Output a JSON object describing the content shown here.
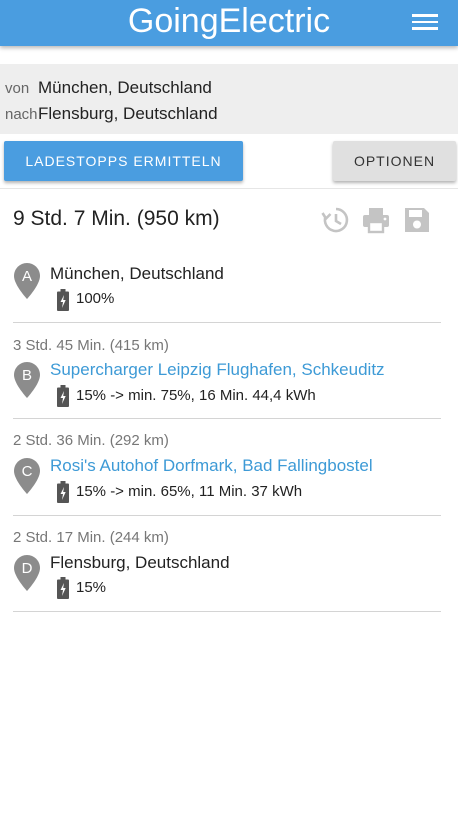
{
  "app": {
    "title": "GoingElectric",
    "menu_icon": "hamburger-menu-icon"
  },
  "route": {
    "from_label": "von",
    "from_value": "München, Deutschland",
    "to_label": "nach",
    "to_value": "Flensburg, Deutschland"
  },
  "buttons": {
    "calculate": "LADESTOPPS ERMITTELN",
    "options": "OPTIONEN"
  },
  "summary": {
    "total": "9 Std. 7 Min. (950 km)",
    "icons": [
      "history-icon",
      "print-icon",
      "save-icon"
    ]
  },
  "stops": [
    {
      "letter": "A",
      "name": "München, Deutschland",
      "is_link": false,
      "charge": "100%"
    },
    {
      "leg": "3 Std. 45 Min. (415 km)",
      "letter": "B",
      "name": "Supercharger Leipzig Flughafen, Schkeuditz",
      "is_link": true,
      "charge": "15% -> min. 75%, 16 Min. 44,4 kWh"
    },
    {
      "leg": "2 Std. 36 Min. (292 km)",
      "letter": "C",
      "name": "Rosi's Autohof Dorfmark, Bad Fallingbostel",
      "is_link": true,
      "charge": "15% -> min. 65%, 11 Min. 37 kWh"
    },
    {
      "leg": "2 Std. 17 Min. (244 km)",
      "letter": "D",
      "name": "Flensburg, Deutschland",
      "is_link": false,
      "charge": "15%"
    }
  ],
  "colors": {
    "primary": "#4a9de0",
    "link": "#3d9ad6",
    "pin": "#8c8c8c",
    "icon_muted": "#c4c4c4"
  }
}
